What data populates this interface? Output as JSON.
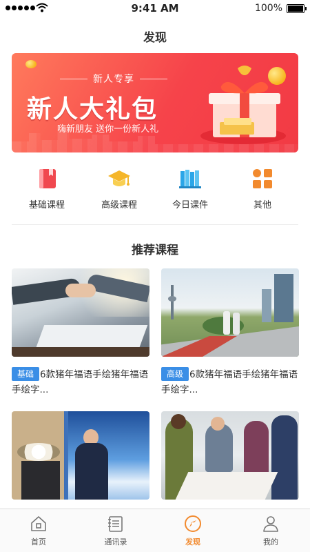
{
  "status_bar": {
    "time": "9:41 AM",
    "battery": "100%"
  },
  "page": {
    "title": "发现"
  },
  "banner": {
    "subtitle": "新人专享",
    "headline": "新人大礼包",
    "tagline": "嗨新朋友 送你一份新人礼"
  },
  "categories": [
    {
      "label": "基础课程",
      "icon": "book-icon",
      "color": "#f0484f"
    },
    {
      "label": "高级课程",
      "icon": "graduation-cap-icon",
      "color": "#f5b62a"
    },
    {
      "label": "今日课件",
      "icon": "books-shelf-icon",
      "color": "#2ba6e8"
    },
    {
      "label": "其他",
      "icon": "grid-icon",
      "color": "#f28a2e"
    }
  ],
  "recommend": {
    "title": "推荐课程",
    "courses": [
      {
        "tag": "基础",
        "title": "6款猪年福语手绘猪年福语手绘字..."
      },
      {
        "tag": "高级",
        "title": "6款猪年福语手绘猪年福语手绘字..."
      },
      {
        "tag": "",
        "title": ""
      },
      {
        "tag": "",
        "title": ""
      }
    ]
  },
  "bottom_nav": [
    {
      "label": "首页",
      "icon": "home-icon"
    },
    {
      "label": "通讯录",
      "icon": "contacts-icon"
    },
    {
      "label": "发现",
      "icon": "discover-icon",
      "active": true
    },
    {
      "label": "我的",
      "icon": "user-icon"
    }
  ],
  "colors": {
    "accent": "#f28a2e",
    "tag_blue": "#3a8ee6",
    "banner_red": "#f6434a"
  }
}
